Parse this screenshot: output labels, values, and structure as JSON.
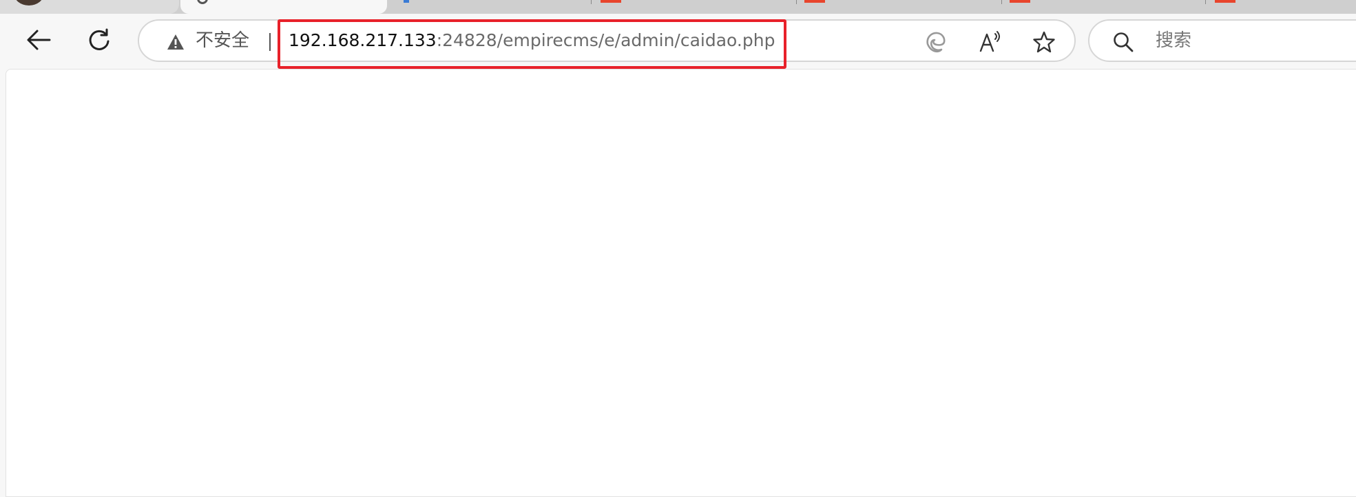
{
  "address_bar": {
    "security_label": "不安全",
    "url_host": "192.168.217.133",
    "url_rest": ":24828/empirecms/e/admin/caidao.php"
  },
  "search_bar": {
    "placeholder": "搜索"
  },
  "icons": {
    "back": "back-arrow-icon",
    "reload": "reload-icon",
    "warning": "warning-triangle-icon",
    "edge": "edge-icon",
    "read_aloud": "read-aloud-icon",
    "favorite": "star-icon",
    "search": "search-icon"
  },
  "colors": {
    "highlight_border": "#e8212a",
    "tab_favicon": "#e8452c"
  }
}
